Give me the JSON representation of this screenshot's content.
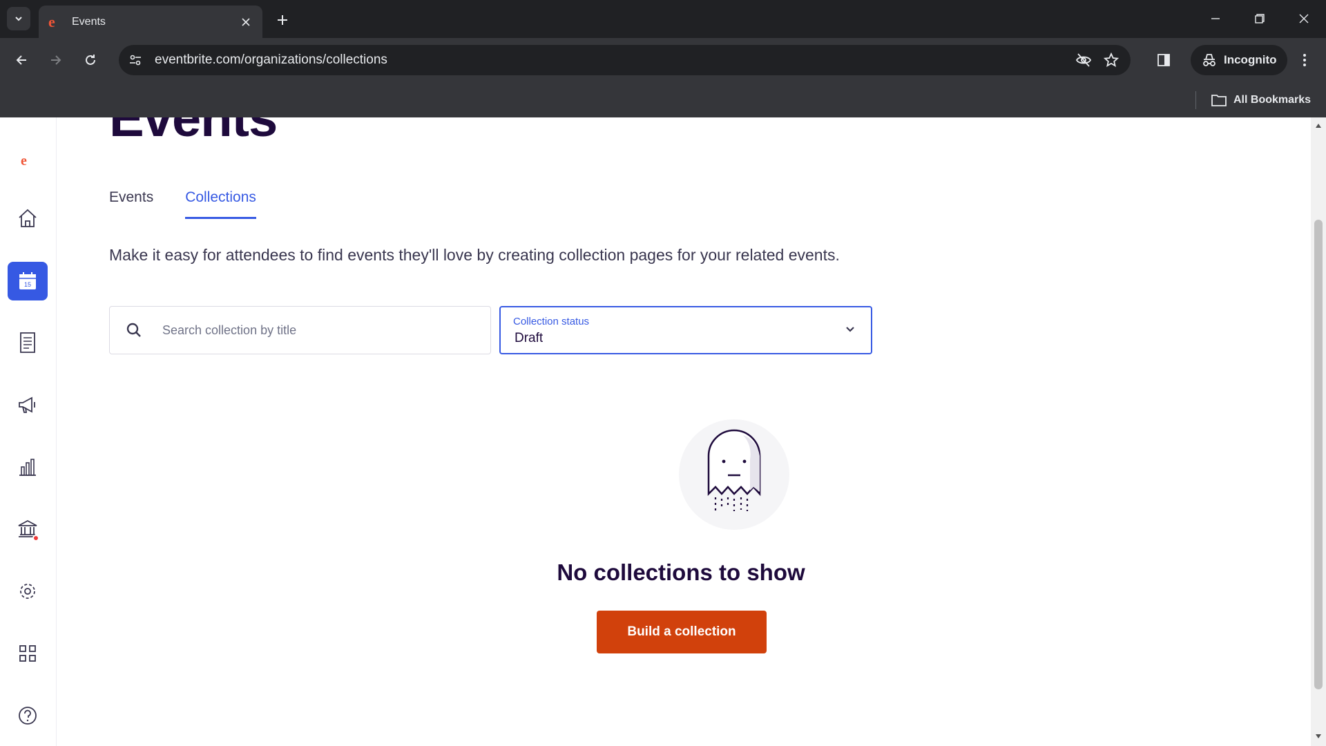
{
  "browser": {
    "tab_title": "Events",
    "url": "eventbrite.com/organizations/collections",
    "incognito_label": "Incognito",
    "all_bookmarks_label": "All Bookmarks"
  },
  "sidebar": {
    "logo": "e",
    "items": [
      {
        "name": "home",
        "icon": "home-icon"
      },
      {
        "name": "events",
        "icon": "calendar-icon",
        "active": true,
        "calendar_day": "15"
      },
      {
        "name": "orders",
        "icon": "receipt-icon"
      },
      {
        "name": "marketing",
        "icon": "megaphone-icon"
      },
      {
        "name": "reporting",
        "icon": "bar-chart-icon"
      },
      {
        "name": "finance",
        "icon": "bank-icon"
      },
      {
        "name": "settings",
        "icon": "gear-icon"
      },
      {
        "name": "apps",
        "icon": "grid-icon"
      },
      {
        "name": "help",
        "icon": "help-icon"
      }
    ]
  },
  "main": {
    "title": "Events",
    "tabs": [
      {
        "label": "Events",
        "active": false
      },
      {
        "label": "Collections",
        "active": true
      }
    ],
    "description": "Make it easy for attendees to find events they'll love by creating collection pages for your related events.",
    "search": {
      "placeholder": "Search collection by title",
      "value": ""
    },
    "status_select": {
      "label": "Collection status",
      "value": "Draft"
    },
    "empty_state": {
      "title": "No collections to show",
      "button_label": "Build a collection"
    }
  },
  "colors": {
    "brand": "#f05537",
    "accent": "#3659e3",
    "cta": "#d1410c",
    "heading": "#1e0a3c"
  }
}
